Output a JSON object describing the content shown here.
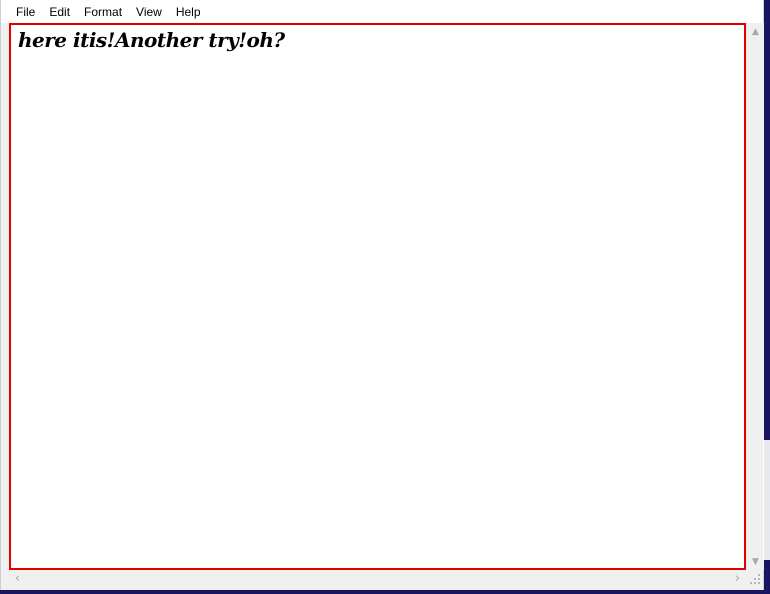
{
  "menubar": {
    "items": [
      {
        "label": "File"
      },
      {
        "label": "Edit"
      },
      {
        "label": "Format"
      },
      {
        "label": "View"
      },
      {
        "label": "Help"
      }
    ]
  },
  "editor": {
    "content": "here itis!Another try!oh?",
    "highlight_color": "#e00000"
  },
  "scrollbars": {
    "up_icon": "chevron-up-icon",
    "down_icon": "chevron-down-icon",
    "left_icon": "chevron-left-icon",
    "right_icon": "chevron-right-icon",
    "grip_icon": "resize-grip-icon"
  },
  "desktop": {
    "background_color": "#1a1560"
  }
}
